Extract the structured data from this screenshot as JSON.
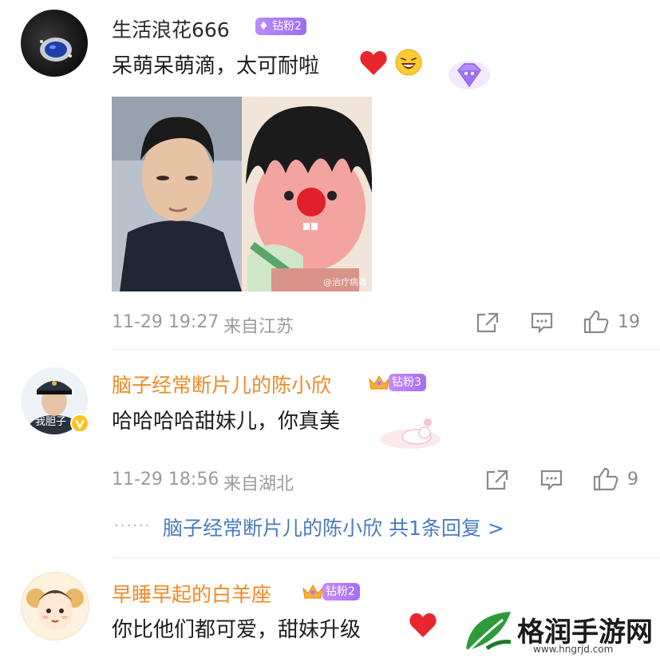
{
  "comments": [
    {
      "username": "生活浪花666",
      "badge": "钻粉2",
      "text": "呆萌呆萌滴，太可耐啦",
      "timestamp": "11-29 19:27",
      "location": "来自江苏",
      "likes": "19"
    },
    {
      "username": "脑子经常断片儿的陈小欣",
      "badge": "钻粉3",
      "text": "哈哈哈哈甜妹儿，你真美",
      "timestamp": "11-29 18:56",
      "location": "来自湖北",
      "likes": "9",
      "reply_author": "脑子经常断片儿的陈小欣",
      "reply_summary": "共1条回复 >"
    },
    {
      "username": "早睡早起的白羊座",
      "badge": "钻粉2",
      "text": "你比他们都可爱，甜妹升级"
    }
  ],
  "image_watermark": "@治疗病毒",
  "watermark": {
    "text": "格润手游网",
    "url": "www.hngrjd.com"
  },
  "colors": {
    "username_orange": "#f08a24",
    "link_blue": "#4a7bc0",
    "badge_purple": "#a26ff5",
    "heart_red": "#e8262e"
  }
}
